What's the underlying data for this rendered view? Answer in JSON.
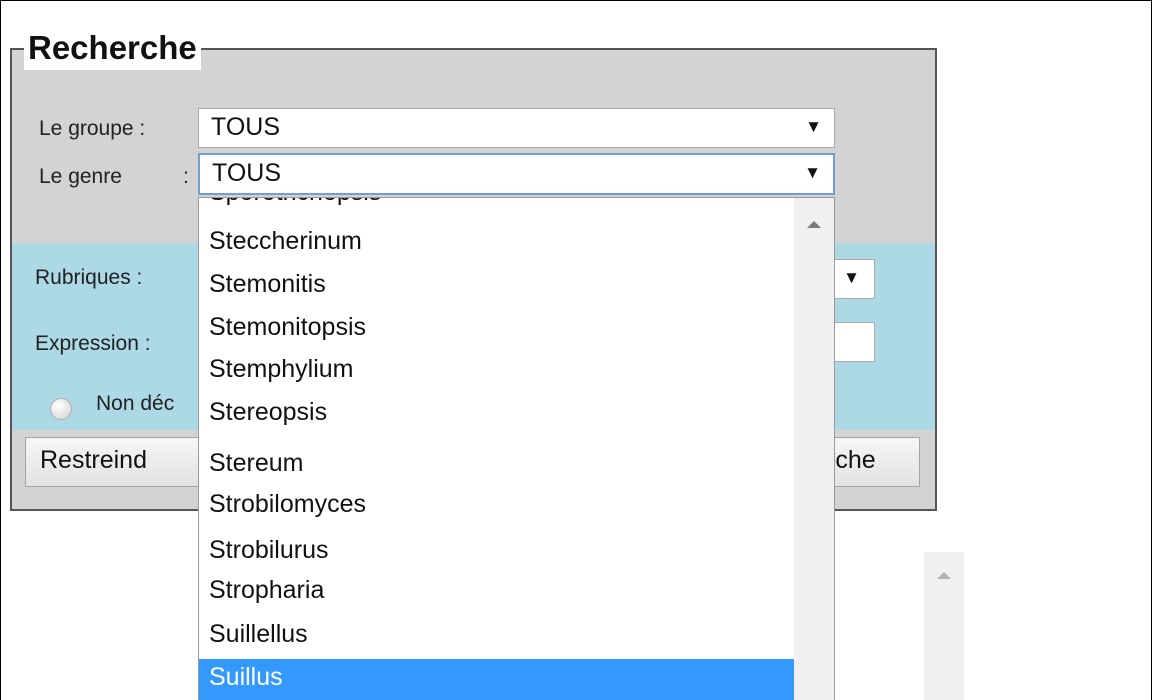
{
  "form": {
    "legend": "Recherche",
    "groupe_label": "Le groupe :",
    "groupe_value": "TOUS",
    "genre_label": "Le genre",
    "genre_colon": ":",
    "genre_value": "TOUS",
    "rubriques_label": "Rubriques :",
    "expression_label": "Expression :",
    "radio_label": "Non déc",
    "restreindre_button": "Restreind",
    "recherche_button": "rche",
    "arrow_glyph": "▼"
  },
  "dropdown": {
    "partial_top": "Sporotrichopsis",
    "items": [
      "Steccherinum",
      "Stemonitis",
      "Stemonitopsis",
      "Stemphylium",
      "Stereopsis",
      "Stereum",
      "Strobilomyces",
      "Strobilurus",
      "Stropharia",
      "Suillellus",
      "Suillus"
    ],
    "selected": "Suillus",
    "selected_color": "#3399ff"
  },
  "icons": {
    "scroll_up": "scroll-up-arrow-icon",
    "dropdown_arrow": "chevron-down-icon"
  }
}
